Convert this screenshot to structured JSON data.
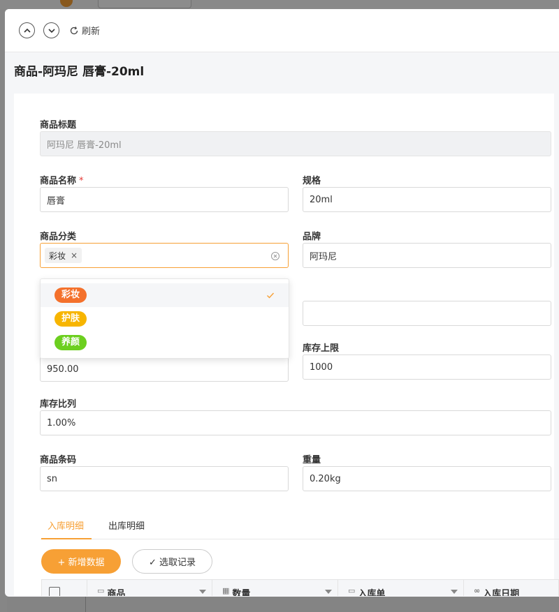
{
  "header": {
    "refresh_label": "刷新"
  },
  "record_title": "商品-阿玛尼 唇膏-20ml",
  "form": {
    "title": {
      "label": "商品标题",
      "value": "阿玛尼 唇膏-20ml"
    },
    "name": {
      "label": "商品名称",
      "required_mark": "*",
      "value": "唇膏"
    },
    "spec": {
      "label": "规格",
      "value": "20ml"
    },
    "category": {
      "label": "商品分类",
      "selected_tag": "彩妆",
      "remove_glyph": "×"
    },
    "brand": {
      "label": "品牌",
      "value": "阿玛尼"
    },
    "stock_lower": {
      "value": "950.00"
    },
    "stock_upper": {
      "label": "库存上限",
      "value": "1000"
    },
    "stock_ratio": {
      "label": "库存比列",
      "value": "1.00%"
    },
    "barcode": {
      "label": "商品条码",
      "value": "sn"
    },
    "weight": {
      "label": "重量",
      "value": "0.20kg"
    }
  },
  "category_dropdown": {
    "options": [
      {
        "label": "彩妆",
        "color": "#f4712c",
        "selected": true
      },
      {
        "label": "护肤",
        "color": "#f7b500",
        "selected": false
      },
      {
        "label": "养颜",
        "color": "#6ccf1f",
        "selected": false
      }
    ]
  },
  "tabs": [
    {
      "label": "入库明细",
      "active": true
    },
    {
      "label": "出库明细",
      "active": false
    }
  ],
  "actions": {
    "add_label": "+ 新增数据",
    "select_label": "✓ 选取记录"
  },
  "table": {
    "columns": [
      "商品",
      "数量",
      "入库单",
      "入库日期"
    ]
  },
  "colors": {
    "accent": "#f7a035"
  }
}
